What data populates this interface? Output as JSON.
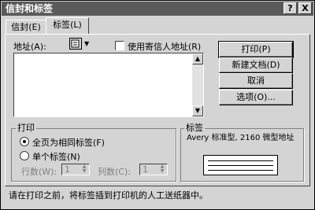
{
  "title": "信封和标签",
  "title_buttons": {
    "help": "?",
    "close": "X"
  },
  "tabs": [
    {
      "label": "信封(E)"
    },
    {
      "label": "标签(L)"
    }
  ],
  "address": {
    "label": "地址(A):",
    "use_return_address": "使用寄信人地址(R)",
    "value": ""
  },
  "buttons": {
    "print": "打印(P)",
    "new_document": "新建文档(D)",
    "cancel": "取消",
    "options": "选项(O)..."
  },
  "print_group": {
    "label": "打印",
    "full_page": "全页为相同标签(F)",
    "single_label": "单个标签(N)",
    "row_label": "行数(W):",
    "row_value": "1",
    "col_label": "列数(C):",
    "col_value": "1"
  },
  "label_group": {
    "label": "标签",
    "description": "Avery 标准型, 2160 微型地址"
  },
  "status_text": "请在打印之前，将标签插到打印机的人工送纸器中。",
  "icons": {
    "address_book": "address-book-icon"
  }
}
